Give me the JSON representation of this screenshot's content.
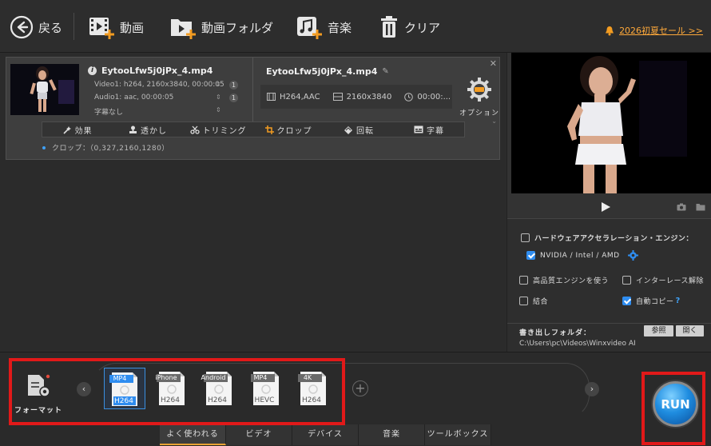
{
  "toolbar": {
    "back_label": "戻る",
    "video_label": "動画",
    "video_folder_label": "動画フォルダ",
    "music_label": "音楽",
    "clear_label": "クリア",
    "promo_label": "2026初夏セール >>"
  },
  "file_card": {
    "source_name": "EytooLfw5j0jPx_4.mp4",
    "video_track": "Video1: h264, 2160x3840, 00:00:05",
    "audio_track": "Audio1: aac, 00:00:05",
    "subtitle_track": "字幕なし",
    "video_track_count": "1",
    "audio_track_count": "1",
    "output_name": "EytooLfw5j0jPx_4.mp4",
    "output_codec": "H264,AAC",
    "output_resolution": "2160x3840",
    "output_duration": "00:00:...",
    "option_label": "オプション",
    "edit_tools": {
      "effect": "効果",
      "watermark": "透かし",
      "trim": "トリミング",
      "crop": "クロップ",
      "rotate": "回転",
      "subtitle": "字幕"
    },
    "crop_note": "クロップ：（0,327,2160,1280）"
  },
  "settings": {
    "hw_accel_label": "ハードウェアアクセラレーション・エンジン：",
    "hw_vendor_label": "NVIDIA / Intel / AMD",
    "hq_engine_label": "高品質エンジンを使う",
    "deinterlace_label": "インターレース解除",
    "merge_label": "結合",
    "auto_copy_label": "自動コピー",
    "help_mark": "?",
    "output_folder_label": "書き出しフォルダ：",
    "output_folder_path": "C:\\Users\\pc\\Videos\\Winxvideo AI",
    "browse_label": "参照",
    "open_label": "開く",
    "hw_accel_checked": false,
    "hw_vendor_checked": true,
    "hq_engine_checked": false,
    "deinterlace_checked": false,
    "merge_checked": false,
    "auto_copy_checked": true
  },
  "format_bar": {
    "format_label": "フォーマット",
    "formats": [
      {
        "top": "MP4",
        "bottom": "H264",
        "selected": true
      },
      {
        "top": "iPhone",
        "bottom": "H264",
        "selected": false
      },
      {
        "top": "Android",
        "bottom": "H264",
        "selected": false
      },
      {
        "top": "MP4",
        "bottom": "HEVC",
        "selected": false
      },
      {
        "top": "4K",
        "bottom": "H264",
        "selected": false
      }
    ],
    "tabs": [
      "よく使われる",
      "ビデオ",
      "デバイス",
      "音楽",
      "ツールボックス"
    ],
    "active_tab": 0
  },
  "run": {
    "label": "RUN"
  },
  "colors": {
    "accent_blue": "#2f8df0",
    "highlight_red": "#e11919",
    "promo_orange": "#ffa93a",
    "tab_active": "#e8a233"
  }
}
